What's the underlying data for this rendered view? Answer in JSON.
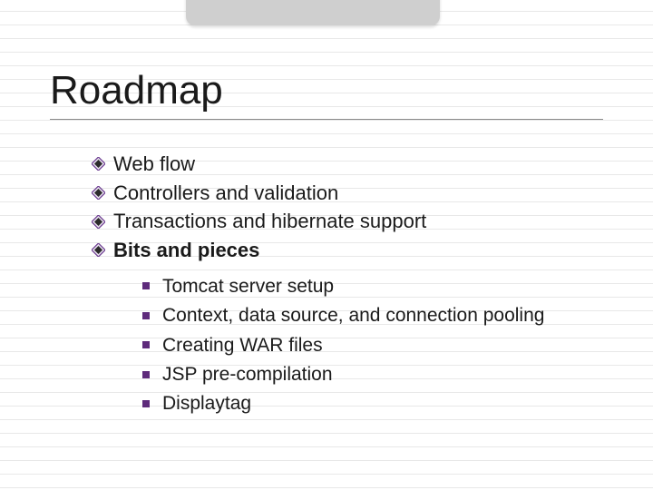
{
  "title": "Roadmap",
  "bullets": [
    {
      "label": "Web flow",
      "bold": false
    },
    {
      "label": "Controllers and validation",
      "bold": false
    },
    {
      "label": "Transactions and hibernate support",
      "bold": false
    },
    {
      "label": "Bits and pieces",
      "bold": true
    }
  ],
  "sub_bullets": [
    {
      "label": "Tomcat server setup"
    },
    {
      "label": "Context, data source, and connection pooling"
    },
    {
      "label": "Creating WAR files"
    },
    {
      "label": "JSP pre-compilation"
    },
    {
      "label": "Displaytag"
    }
  ],
  "colors": {
    "accent_purple": "#5e2b7b",
    "tab_grey": "#cfcfcf"
  }
}
